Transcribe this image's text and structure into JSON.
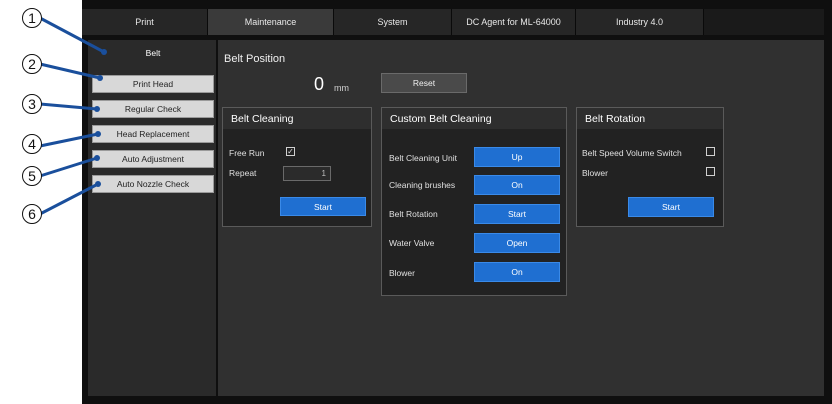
{
  "tabs": [
    {
      "label": "Print",
      "active": false
    },
    {
      "label": "Maintenance",
      "active": true
    },
    {
      "label": "System",
      "active": false
    },
    {
      "label": "DC Agent for ML-64000",
      "active": false
    },
    {
      "label": "Industry 4.0",
      "active": false
    }
  ],
  "sidebar": {
    "items": [
      {
        "label": "Belt",
        "active": true
      },
      {
        "label": "Print Head",
        "active": false
      },
      {
        "label": "Regular Check",
        "active": false
      },
      {
        "label": "Head Replacement",
        "active": false
      },
      {
        "label": "Auto Adjustment",
        "active": false
      },
      {
        "label": "Auto Nozzle Check",
        "active": false
      }
    ]
  },
  "callouts": [
    "1",
    "2",
    "3",
    "4",
    "5",
    "6"
  ],
  "belt_position": {
    "title": "Belt Position",
    "value": "0",
    "unit": "mm",
    "reset_label": "Reset"
  },
  "belt_cleaning": {
    "title": "Belt Cleaning",
    "free_run_label": "Free Run",
    "free_run_checked": true,
    "repeat_label": "Repeat",
    "repeat_value": "1",
    "start_label": "Start"
  },
  "custom_belt_cleaning": {
    "title": "Custom Belt Cleaning",
    "rows": [
      {
        "label": "Belt Cleaning Unit",
        "button": "Up"
      },
      {
        "label": "Cleaning brushes",
        "button": "On"
      },
      {
        "label": "Belt Rotation",
        "button": "Start"
      },
      {
        "label": "Water Valve",
        "button": "Open"
      },
      {
        "label": "Blower",
        "button": "On"
      }
    ]
  },
  "belt_rotation": {
    "title": "Belt Rotation",
    "speed_switch_label": "Belt Speed Volume Switch",
    "blower_label": "Blower",
    "start_label": "Start"
  },
  "colors": {
    "accent_blue": "#1f6fd1",
    "background": "#0f0f0f",
    "panel": "#222222"
  }
}
